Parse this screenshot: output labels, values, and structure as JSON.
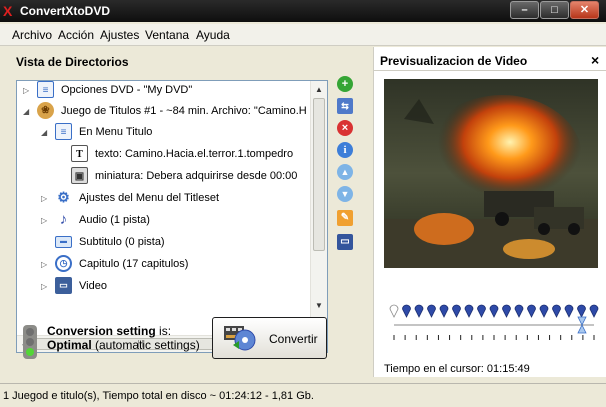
{
  "window": {
    "title": "ConvertXtoDVD"
  },
  "menu": [
    "Archivo",
    "Acción",
    "Ajustes",
    "Ventana",
    "Ayuda"
  ],
  "left_panel": {
    "title": "Vista de Directorios",
    "tree": [
      {
        "label": "Opciones DVD - \"My DVD\"",
        "icon": "list-icon"
      },
      {
        "label": "Juego de Titulos #1 - ~84 min. Archivo: \"Camino.H",
        "icon": "film-reel-icon"
      },
      {
        "label": "En Menu Titulo",
        "icon": "list-icon"
      },
      {
        "label": "texto: Camino.Hacia.el.terror.1.tompedro",
        "icon": "text-icon"
      },
      {
        "label": "miniatura: Debera adquirirse desde 00:00",
        "icon": "image-icon"
      },
      {
        "label": "Ajustes del Menu del Titleset",
        "icon": "gear-icon"
      },
      {
        "label": "Audio (1 pista)",
        "icon": "music-note-icon"
      },
      {
        "label": "Subtitulo (0 pista)",
        "icon": "subtitle-icon"
      },
      {
        "label": "Capitulo (17 capitulos)",
        "icon": "clock-icon"
      },
      {
        "label": "Video",
        "icon": "video-icon"
      }
    ]
  },
  "toolbar": {
    "icons": [
      "add-icon",
      "merge-icon",
      "delete-icon",
      "info-icon",
      "move-up-icon",
      "move-down-icon",
      "edit-icon",
      "monitor-icon"
    ]
  },
  "conversion": {
    "setting_bold": "Conversion setting",
    "setting_rest": " is:",
    "value_bold": "Optimal",
    "value_rest": " (automatic settings)",
    "colors": {
      "red": "#6f6f6f",
      "yellow": "#6f6f6f",
      "green": "#52d636"
    }
  },
  "convert_button": {
    "label": "Convertir"
  },
  "right_panel": {
    "title": "Previsualizacion de Video",
    "close_glyph": "×",
    "cursor_label": "Tiempo en el cursor:",
    "cursor_time": "01:15:49",
    "timeline": {
      "chapter_markers": 17,
      "cursor_position": 0.94
    }
  },
  "status_bar": {
    "text": "1 Juegod e titulo(s), Tiempo total en disco ~ 01:24:12 - 1,81 Gb."
  },
  "colors": {
    "accent_blue": "#3a6fc7",
    "tree_border": "#7f9db9",
    "marker_blue": "#2e4aa8"
  }
}
